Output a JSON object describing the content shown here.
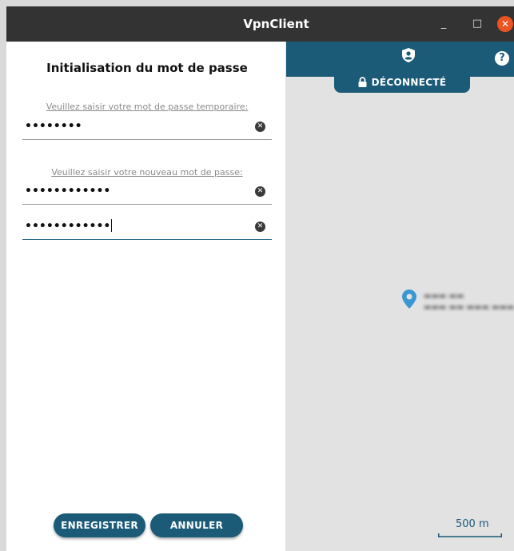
{
  "window": {
    "title": "VpnClient",
    "min_label": "_",
    "max_label": "□",
    "close_label": "✕"
  },
  "form": {
    "heading": "Initialisation du mot de passe",
    "temp_hint": "Veuillez saisir votre mot de passe temporaire:",
    "temp_value": "••••••••",
    "new_hint": "Veuillez saisir votre nouveau mot de passe:",
    "new_value": "••••••••••••",
    "confirm_value": "••••••••••••",
    "clear_glyph": "✕",
    "save_label": "ENREGISTRER",
    "cancel_label": "ANNULER"
  },
  "vpn": {
    "status_label": "DÉCONNECTÉ",
    "help_label": "?",
    "scale_label": "500 m"
  },
  "colors": {
    "accent": "#1b5b78",
    "close": "#e95420",
    "pin": "#3b97d3"
  }
}
